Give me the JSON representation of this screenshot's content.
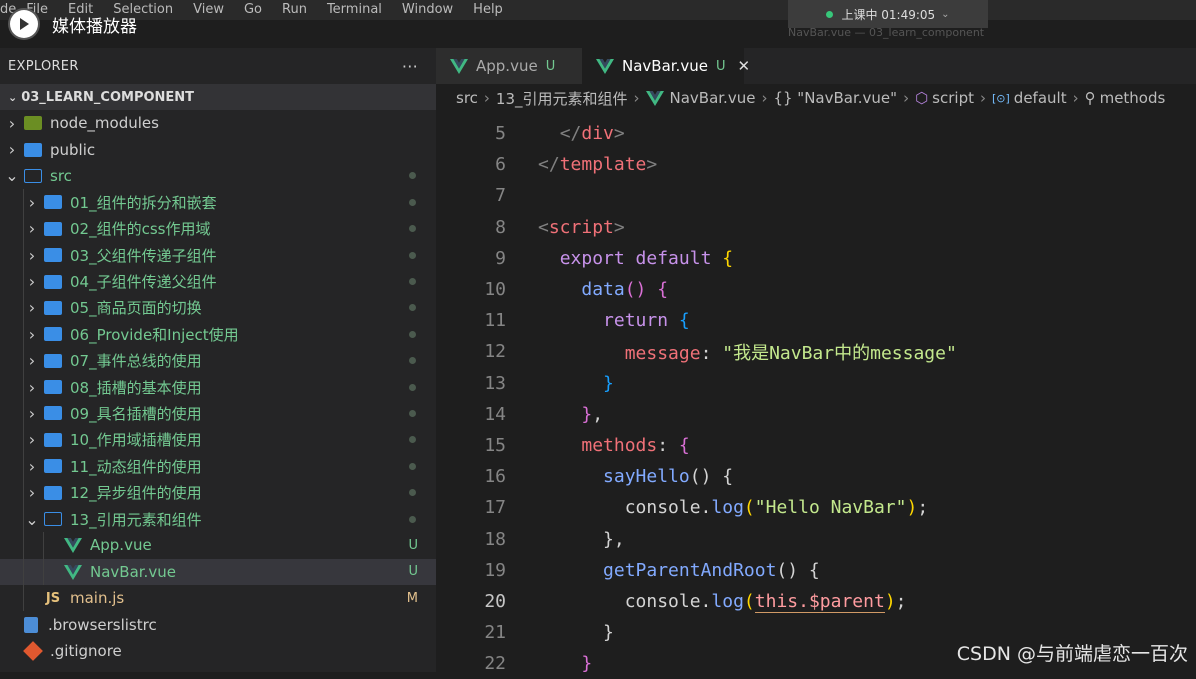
{
  "menubar": {
    "app_fragment": "de",
    "items": [
      "File",
      "Edit",
      "Selection",
      "View",
      "Go",
      "Run",
      "Terminal",
      "Window",
      "Help"
    ]
  },
  "media_player": {
    "title": "媒体播放器"
  },
  "live_badge": {
    "text": "上课中 01:49:05"
  },
  "window_title": "NavBar.vue — 03_learn_component",
  "explorer": {
    "title": "EXPLORER",
    "more": "···",
    "root": "03_LEARN_COMPONENT",
    "items": [
      {
        "label": "node_modules",
        "type": "folder-nm",
        "depth": 0,
        "chevron": "›",
        "status": ""
      },
      {
        "label": "public",
        "type": "folder",
        "depth": 0,
        "chevron": "›",
        "status": ""
      },
      {
        "label": "src",
        "type": "folder-open",
        "depth": 0,
        "chevron": "⌄",
        "status": "dot",
        "green": true
      },
      {
        "label": "01_组件的拆分和嵌套",
        "type": "folder",
        "depth": 1,
        "chevron": "›",
        "status": "dot",
        "green": true
      },
      {
        "label": "02_组件的css作用域",
        "type": "folder",
        "depth": 1,
        "chevron": "›",
        "status": "dot",
        "green": true
      },
      {
        "label": "03_父组件传递子组件",
        "type": "folder",
        "depth": 1,
        "chevron": "›",
        "status": "dot",
        "green": true
      },
      {
        "label": "04_子组件传递父组件",
        "type": "folder",
        "depth": 1,
        "chevron": "›",
        "status": "dot",
        "green": true
      },
      {
        "label": "05_商品页面的切换",
        "type": "folder",
        "depth": 1,
        "chevron": "›",
        "status": "dot",
        "green": true
      },
      {
        "label": "06_Provide和Inject使用",
        "type": "folder",
        "depth": 1,
        "chevron": "›",
        "status": "dot",
        "green": true
      },
      {
        "label": "07_事件总线的使用",
        "type": "folder",
        "depth": 1,
        "chevron": "›",
        "status": "dot",
        "green": true
      },
      {
        "label": "08_插槽的基本使用",
        "type": "folder",
        "depth": 1,
        "chevron": "›",
        "status": "dot",
        "green": true
      },
      {
        "label": "09_具名插槽的使用",
        "type": "folder",
        "depth": 1,
        "chevron": "›",
        "status": "dot",
        "green": true
      },
      {
        "label": "10_作用域插槽使用",
        "type": "folder",
        "depth": 1,
        "chevron": "›",
        "status": "dot",
        "green": true
      },
      {
        "label": "11_动态组件的使用",
        "type": "folder",
        "depth": 1,
        "chevron": "›",
        "status": "dot",
        "green": true
      },
      {
        "label": "12_异步组件的使用",
        "type": "folder",
        "depth": 1,
        "chevron": "›",
        "status": "dot",
        "green": true
      },
      {
        "label": "13_引用元素和组件",
        "type": "folder-open",
        "depth": 1,
        "chevron": "⌄",
        "status": "dot",
        "green": true
      },
      {
        "label": "App.vue",
        "type": "vue",
        "depth": 2,
        "chevron": "",
        "status": "U",
        "green": true
      },
      {
        "label": "NavBar.vue",
        "type": "vue",
        "depth": 2,
        "chevron": "",
        "status": "U",
        "green": true,
        "selected": true
      },
      {
        "label": "main.js",
        "type": "js",
        "depth": 1,
        "chevron": "",
        "status": "M",
        "yellow": true
      },
      {
        "label": ".browserslistrc",
        "type": "file",
        "depth": 0,
        "chevron": "",
        "status": ""
      },
      {
        "label": ".gitignore",
        "type": "git",
        "depth": 0,
        "chevron": "",
        "status": ""
      }
    ]
  },
  "tabs": [
    {
      "label": "App.vue",
      "status": "U",
      "active": false
    },
    {
      "label": "NavBar.vue",
      "status": "U",
      "active": true,
      "close": "✕"
    }
  ],
  "breadcrumb": [
    "src",
    "13_引用元素和组件",
    "NavBar.vue",
    "{} \"NavBar.vue\"",
    "script",
    "default",
    "methods"
  ],
  "code": {
    "current_line": 20,
    "lines": [
      {
        "n": 5,
        "indent": 1,
        "tokens": [
          [
            "punc",
            "</"
          ],
          [
            "tag",
            "div"
          ],
          [
            "punc",
            ">"
          ]
        ]
      },
      {
        "n": 6,
        "indent": 0,
        "tokens": [
          [
            "punc",
            "</"
          ],
          [
            "tag",
            "template"
          ],
          [
            "punc",
            ">"
          ]
        ]
      },
      {
        "n": 7,
        "indent": 0,
        "tokens": []
      },
      {
        "n": 8,
        "indent": 0,
        "tokens": [
          [
            "punc",
            "<"
          ],
          [
            "tag",
            "script"
          ],
          [
            "punc",
            ">"
          ]
        ]
      },
      {
        "n": 9,
        "indent": 1,
        "tokens": [
          [
            "kw",
            "export default "
          ],
          [
            "y",
            "{"
          ]
        ]
      },
      {
        "n": 10,
        "indent": 2,
        "tokens": [
          [
            "f",
            "data"
          ],
          [
            "p",
            "()"
          ],
          [
            "cons",
            " "
          ],
          [
            "p",
            "{"
          ]
        ]
      },
      {
        "n": 11,
        "indent": 3,
        "tokens": [
          [
            "kw",
            "return "
          ],
          [
            "b",
            "{"
          ]
        ]
      },
      {
        "n": 12,
        "indent": 4,
        "tokens": [
          [
            "prop",
            "message"
          ],
          [
            "cons",
            ": "
          ],
          [
            "str",
            "\"我是NavBar中的message\""
          ]
        ]
      },
      {
        "n": 13,
        "indent": 3,
        "tokens": [
          [
            "b",
            "}"
          ]
        ]
      },
      {
        "n": 14,
        "indent": 2,
        "tokens": [
          [
            "p",
            "}"
          ],
          [
            "cons",
            ","
          ]
        ]
      },
      {
        "n": 15,
        "indent": 2,
        "tokens": [
          [
            "prop",
            "methods"
          ],
          [
            "cons",
            ": "
          ],
          [
            "p",
            "{"
          ]
        ]
      },
      {
        "n": 16,
        "indent": 3,
        "tokens": [
          [
            "f",
            "sayHello"
          ],
          [
            "cons",
            "() {"
          ]
        ]
      },
      {
        "n": 17,
        "indent": 4,
        "tokens": [
          [
            "cons",
            "console."
          ],
          [
            "f",
            "log"
          ],
          [
            "y",
            "("
          ],
          [
            "str",
            "\"Hello NavBar\""
          ],
          [
            "y",
            ")"
          ],
          [
            "cons",
            ";"
          ]
        ]
      },
      {
        "n": 18,
        "indent": 3,
        "tokens": [
          [
            "cons",
            "},"
          ]
        ]
      },
      {
        "n": 19,
        "indent": 3,
        "tokens": [
          [
            "f",
            "getParentAndRoot"
          ],
          [
            "cons",
            "() {"
          ]
        ]
      },
      {
        "n": 20,
        "indent": 4,
        "tokens": [
          [
            "cons",
            "console."
          ],
          [
            "f",
            "log"
          ],
          [
            "y",
            "("
          ],
          [
            "this",
            "this.$parent"
          ],
          [
            "y",
            ")"
          ],
          [
            "cons",
            ";"
          ]
        ]
      },
      {
        "n": 21,
        "indent": 3,
        "tokens": [
          [
            "cons",
            "}"
          ]
        ]
      },
      {
        "n": 22,
        "indent": 2,
        "tokens": [
          [
            "p",
            "}"
          ]
        ]
      }
    ]
  },
  "watermark": "CSDN @与前端虐恋一百次"
}
